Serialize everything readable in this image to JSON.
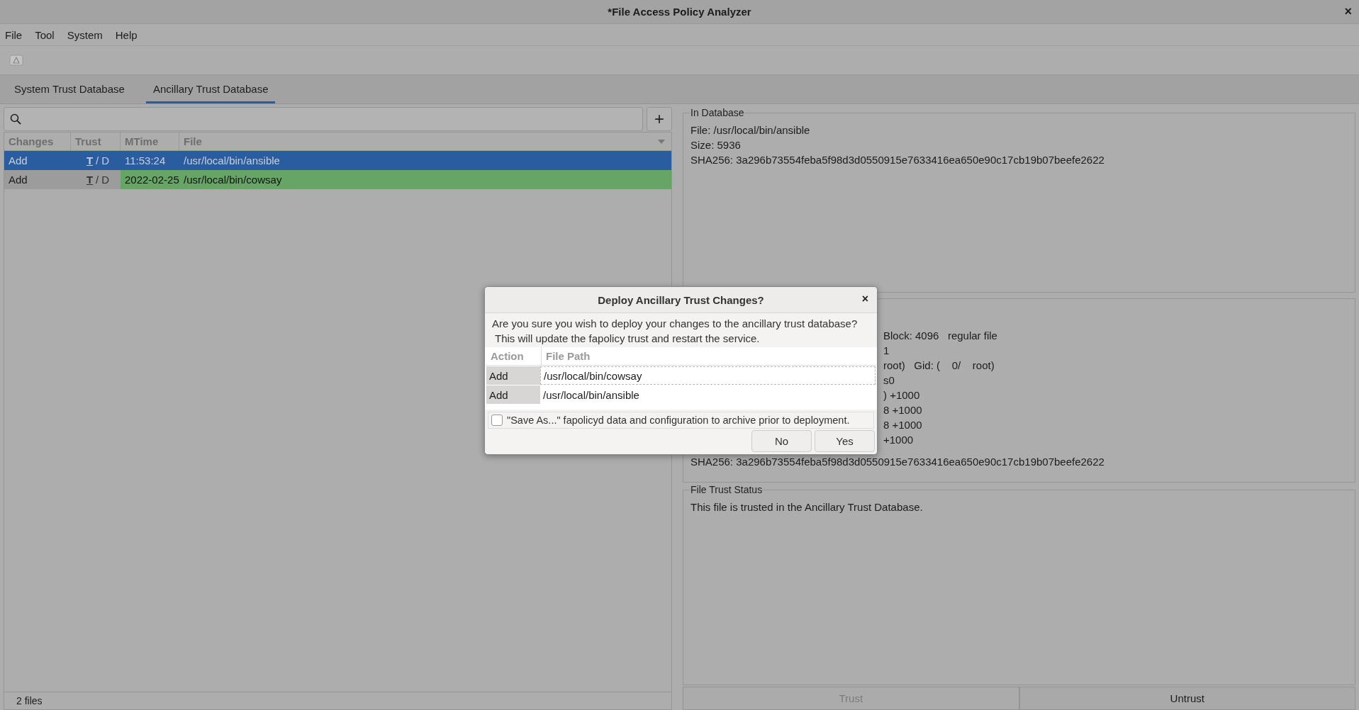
{
  "window": {
    "title": "*File Access Policy Analyzer",
    "close": "×"
  },
  "menu": [
    "File",
    "Tool",
    "System",
    "Help"
  ],
  "tabs": [
    {
      "label": "System Trust Database",
      "selected": false
    },
    {
      "label": "Ancillary Trust Database",
      "selected": true
    }
  ],
  "add_button": "+",
  "table": {
    "columns": [
      "Changes",
      "Trust",
      "MTime",
      "File"
    ],
    "rows": [
      {
        "changes": "Add",
        "trust": [
          {
            "letter": "T",
            "active": true
          },
          {
            "letter": "D",
            "active": false
          }
        ],
        "trust_separator": "/",
        "mtime": "11:53:24",
        "file": "/usr/local/bin/ansible",
        "selected": true
      },
      {
        "changes": "Add",
        "trust": [
          {
            "letter": "T",
            "active": true
          },
          {
            "letter": "D",
            "active": false
          }
        ],
        "trust_separator": "/",
        "mtime": "2022-02-25",
        "file": "/usr/local/bin/cowsay",
        "selected": false,
        "color": "#66a566"
      }
    ]
  },
  "status_bar": "2 files",
  "in_database": {
    "title": "In Database",
    "lines": [
      "File: /usr/local/bin/ansible",
      "Size: 5936",
      "SHA256: 3a296b73554feba5f98d3d0550915e7633416ea650e90c17cb19b07beefe2622"
    ]
  },
  "on_disk": {
    "lines": [
      "Block: 4096   regular file",
      "1",
      "root)   Gid: (    0/    root)",
      "s0",
      ") +1000",
      "8 +1000",
      "8 +1000",
      "+1000"
    ],
    "sha": "SHA256: 3a296b73554feba5f98d3d0550915e7633416ea650e90c17cb19b07beefe2622"
  },
  "trust_status": {
    "title": "File Trust Status",
    "text": "This file is trusted in the Ancillary Trust Database."
  },
  "buttons": [
    {
      "label": "Trust",
      "disabled": true
    },
    {
      "label": "Untrust",
      "disabled": false
    }
  ],
  "dialog": {
    "title": "Deploy Ancillary Trust Changes?",
    "close": "×",
    "message": [
      "Are you sure you wish to deploy your changes to the ancillary trust database?",
      "This will update the fapolicy trust and restart the service."
    ],
    "columns": [
      "Action",
      "File Path"
    ],
    "rows": [
      {
        "action": "Add",
        "path": "/usr/local/bin/cowsay",
        "focused": true
      },
      {
        "action": "Add",
        "path": "/usr/local/bin/ansible",
        "focused": false
      }
    ],
    "checkbox": {
      "label": "\"Save As...\" fapolicyd data and configuration to archive prior to deployment.",
      "checked": false
    },
    "buttons": [
      "No",
      "Yes"
    ]
  }
}
